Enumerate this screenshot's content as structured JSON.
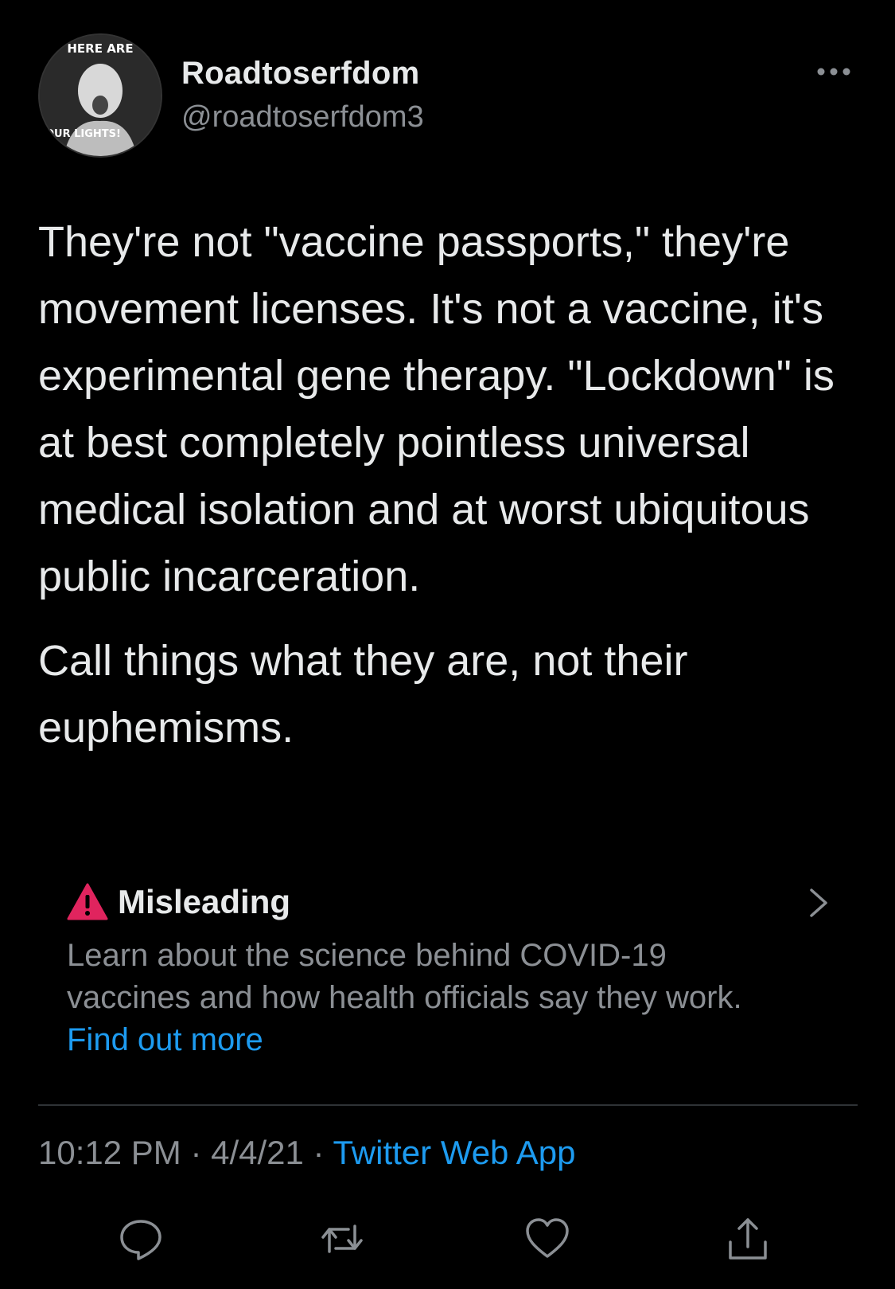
{
  "user": {
    "display_name": "Roadtoserfdom",
    "handle": "@roadtoserfdom3",
    "avatar_text_top": "HERE ARE",
    "avatar_text_bottom": "FOUR LIGHTS!"
  },
  "tweet": {
    "paragraphs": [
      "They're not \"vaccine passports,\" they're movement licenses. It's not a vaccine, it's experimental gene therapy. \"Lockdown\" is at best completely pointless universal medical isolation and at worst ubiquitous public incarceration.",
      "Call things what they are, not their euphemisms."
    ]
  },
  "notice": {
    "title": "Misleading",
    "body": "Learn about the science behind COVID-19 vaccines and how health officials say they work. ",
    "link": "Find out more",
    "icon": "warning-triangle-icon"
  },
  "meta": {
    "time": "10:12 PM",
    "separator": " · ",
    "date": "4/4/21",
    "source": "Twitter Web App"
  },
  "actions": [
    "reply-icon",
    "retweet-icon",
    "like-icon",
    "share-icon"
  ],
  "colors": {
    "background": "#000000",
    "text": "#e7e9ea",
    "secondary": "#8b8f94",
    "link": "#1d9bf0",
    "warning": "#e0245e"
  }
}
